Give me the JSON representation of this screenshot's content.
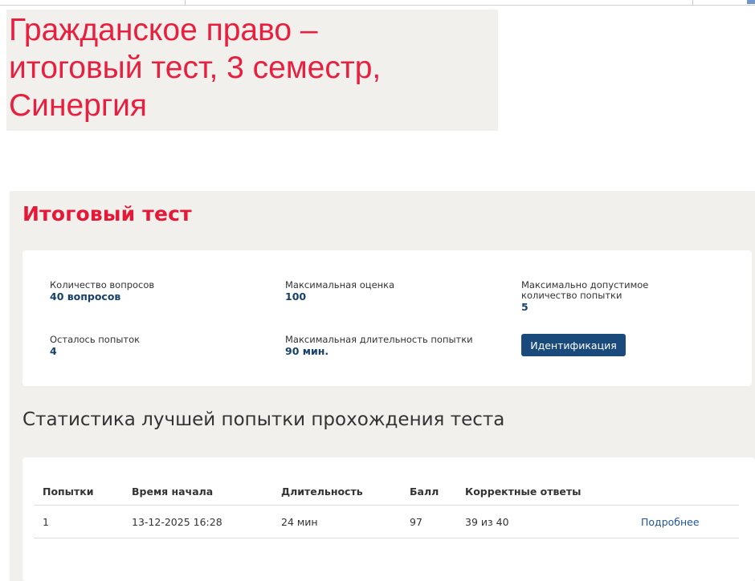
{
  "banner": {
    "title": "Гражданское право –\nитоговый тест, 3 семестр,\nСинергия"
  },
  "panel": {
    "title": "Итоговый тест"
  },
  "info": {
    "questions_label": "Количество вопросов",
    "questions_value": "40 вопросов",
    "max_grade_label": "Максимальная оценка",
    "max_grade_value": "100",
    "max_attempts_label": "Максимально допустимое количество попытки",
    "max_attempts_value": "5",
    "attempts_left_label": "Осталось попыток",
    "attempts_left_value": "4",
    "max_duration_label": "Максимальная длительность попытки",
    "max_duration_value": "90 мин.",
    "identify_button": "Идентификация"
  },
  "stats": {
    "heading": "Статистика лучшей попытки прохождения теста",
    "columns": [
      "Попытки",
      "Время начала",
      "Длительность",
      "Балл",
      "Корректные ответы"
    ],
    "rows": [
      {
        "attempt": "1",
        "start_time": "13-12-2025 16:28",
        "duration": "24 мин",
        "score": "97",
        "correct": "39 из 40",
        "details_link": "Подробнее"
      }
    ]
  }
}
